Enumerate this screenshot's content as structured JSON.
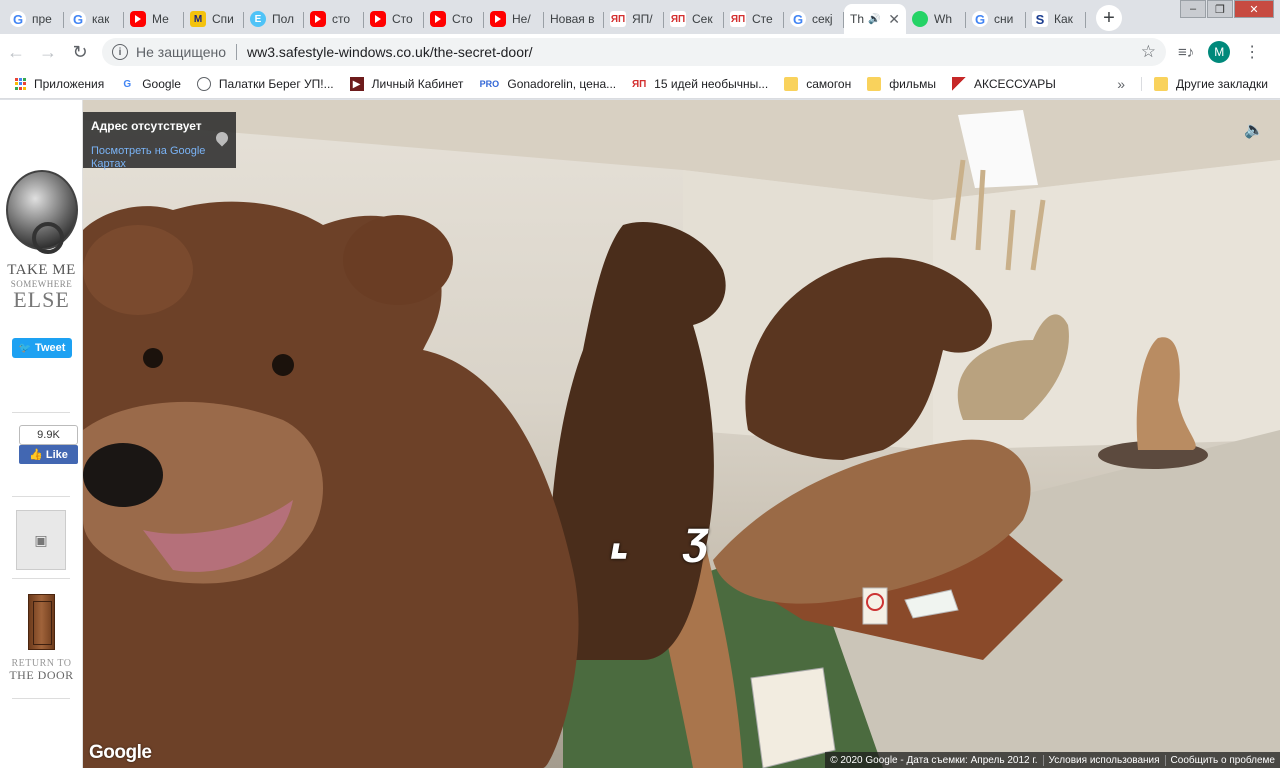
{
  "tabs": [
    {
      "label": "пре",
      "icon": "google-icon"
    },
    {
      "label": "как",
      "icon": "google-icon"
    },
    {
      "label": "Ме",
      "icon": "youtube-icon"
    },
    {
      "label": "Спи",
      "icon": "site-m-icon"
    },
    {
      "label": "Пол",
      "icon": "site-e-icon"
    },
    {
      "label": "сто",
      "icon": "youtube-icon"
    },
    {
      "label": "Сто",
      "icon": "youtube-icon"
    },
    {
      "label": "Сто",
      "icon": "youtube-icon"
    },
    {
      "label": "Не/",
      "icon": "youtube-icon"
    },
    {
      "label": "Новая в",
      "icon": ""
    },
    {
      "label": "ЯП/",
      "icon": "red-logo-icon"
    },
    {
      "label": "Сек",
      "icon": "red-logo-icon"
    },
    {
      "label": "Сте",
      "icon": "red-logo-icon"
    },
    {
      "label": "секј",
      "icon": "google-icon"
    },
    {
      "label": "Th",
      "icon": "",
      "active": true
    },
    {
      "label": "Wh",
      "icon": "whatsapp-icon"
    },
    {
      "label": "сни",
      "icon": "google-icon"
    },
    {
      "label": "Как",
      "icon": "site-s-icon"
    }
  ],
  "omnibox": {
    "security_label": "Не защищено",
    "url": "ww3.safestyle-windows.co.uk/the-secret-door/"
  },
  "profile_initial": "M",
  "bookmarks": [
    {
      "label": "Приложения",
      "icon": "apps-icon"
    },
    {
      "label": "Google",
      "icon": "google-icon"
    },
    {
      "label": "Палатки Берег УП!...",
      "icon": "globe-icon"
    },
    {
      "label": "Личный Кабинет",
      "icon": "lk-icon"
    },
    {
      "label": "Gonadorelin, цена...",
      "icon": "pro-icon"
    },
    {
      "label": "15 идей необычны...",
      "icon": "red-logo-icon"
    },
    {
      "label": "самогон",
      "icon": "folder-icon"
    },
    {
      "label": "фильмы",
      "icon": "folder-icon"
    },
    {
      "label": "АКСЕССУАРЫ",
      "icon": "flag-icon"
    }
  ],
  "bookmarks_more": "»",
  "bookmarks_other": "Другие закладки",
  "sidebar": {
    "take_me": "TAKE ME",
    "somewhere": "SOMEWHERE",
    "else": "ELSE",
    "tweet": "Tweet",
    "like_count": "9.9K",
    "like": "Like",
    "return_to": "RETURN TO",
    "the_door": "THE DOOR"
  },
  "streetview": {
    "address": "Адрес отсутствует",
    "maps_link": "Посмотреть на Google Картах",
    "google_logo": "Google",
    "footer": {
      "copyright": "© 2020 Google - Дата съемки: Апрель 2012 г.",
      "terms": "Условия использования",
      "report": "Сообщить о проблеме"
    }
  },
  "colors": {
    "tweet": "#1da1f2",
    "facebook": "#4267b2",
    "link": "#7ab3f5"
  }
}
